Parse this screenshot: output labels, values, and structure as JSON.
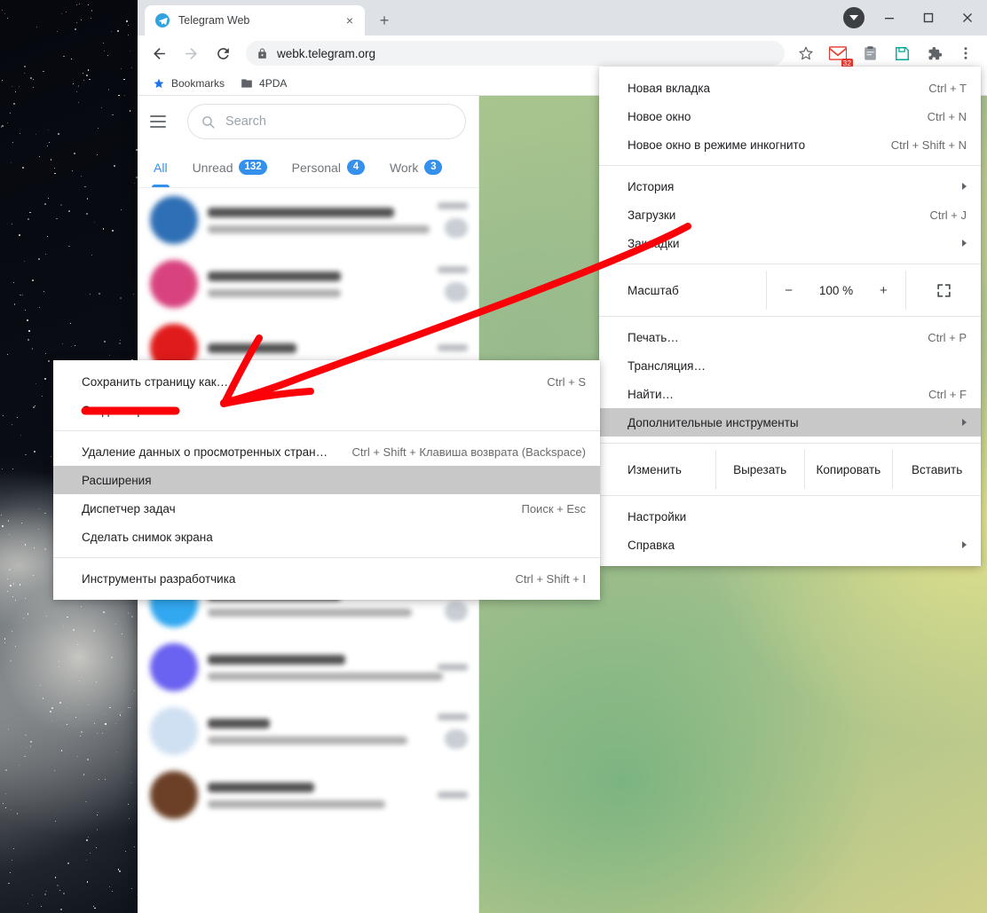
{
  "browser": {
    "tab": {
      "title": "Telegram Web",
      "favicon": "telegram-icon",
      "close": "×"
    },
    "newtab_label": "+",
    "window_controls": {
      "minimize": "—",
      "maximize": "☐",
      "close": "✕"
    },
    "toolbar": {
      "back": "back-arrow-icon",
      "forward": "forward-arrow-icon",
      "reload": "reload-icon",
      "url": "webk.telegram.org",
      "lock": "lock-icon",
      "bookmark_star": "star-icon",
      "gmail_badge": "32",
      "extensions": "puzzle-icon",
      "menu": "three-dot-menu-icon"
    },
    "bookmarks": [
      {
        "label": "Bookmarks",
        "icon": "star-icon"
      },
      {
        "label": "4PDA",
        "icon": "folder-icon"
      }
    ]
  },
  "telegram": {
    "search_placeholder": "Search",
    "menu_icon": "hamburger-icon",
    "tabs": [
      {
        "label": "All",
        "count": "",
        "active": true
      },
      {
        "label": "Unread",
        "count": "132",
        "active": false
      },
      {
        "label": "Personal",
        "count": "4",
        "active": false
      },
      {
        "label": "Work",
        "count": "3",
        "active": false
      }
    ],
    "chats": [
      {
        "avatar_color": "#2f6fb5",
        "title_w": 210,
        "sub_w": 250,
        "unread": true,
        "green": false
      },
      {
        "avatar_color": "#d8437e",
        "title_w": 150,
        "sub_w": 150,
        "unread": true,
        "green": false
      },
      {
        "avatar_color": "#e01b1b",
        "title_w": 100,
        "sub_w": 0,
        "unread": false,
        "green": false
      },
      {
        "avatar_color": "#6d7f8f",
        "title_w": 160,
        "sub_w": 220,
        "unread": true,
        "green": false
      },
      {
        "avatar_color": "#4a2a63",
        "title_w": 80,
        "sub_w": 235,
        "unread": true,
        "green": false
      },
      {
        "avatar_color": "#2ca0e8",
        "title_w": 120,
        "sub_w": 255,
        "unread": false,
        "green": false
      },
      {
        "avatar_color": "#32a8f0",
        "title_w": 150,
        "sub_w": 230,
        "unread": true,
        "green": false
      },
      {
        "avatar_color": "#6a62f0",
        "title_w": 155,
        "sub_w": 265,
        "unread": false,
        "green": true
      },
      {
        "avatar_color": "#cfe0f2",
        "title_w": 70,
        "sub_w": 225,
        "unread": true,
        "green": false
      },
      {
        "avatar_color": "#6b4026",
        "title_w": 120,
        "sub_w": 200,
        "unread": false,
        "green": false
      }
    ]
  },
  "chrome_menu": {
    "items": [
      {
        "label": "Новая вкладка",
        "accel": "Ctrl + T",
        "type": "item"
      },
      {
        "label": "Новое окно",
        "accel": "Ctrl + N",
        "type": "item"
      },
      {
        "label": "Новое окно в режиме инкогнито",
        "accel": "Ctrl + Shift + N",
        "type": "item"
      },
      {
        "type": "separator"
      },
      {
        "label": "История",
        "accel": "",
        "type": "submenu"
      },
      {
        "label": "Загрузки",
        "accel": "Ctrl + J",
        "type": "item"
      },
      {
        "label": "Закладки",
        "accel": "",
        "type": "submenu"
      },
      {
        "type": "separator"
      },
      {
        "type": "zoom",
        "label": "Масштаб",
        "minus": "−",
        "value": "100 %",
        "plus": "+",
        "fullscreen_icon": "fullscreen-icon"
      },
      {
        "type": "separator"
      },
      {
        "label": "Печать…",
        "accel": "Ctrl + P",
        "type": "item"
      },
      {
        "label": "Трансляция…",
        "accel": "",
        "type": "item"
      },
      {
        "label": "Найти…",
        "accel": "Ctrl + F",
        "type": "item"
      },
      {
        "label": "Дополнительные инструменты",
        "accel": "",
        "type": "submenu",
        "highlighted": true
      },
      {
        "type": "separator"
      },
      {
        "type": "edit_row",
        "cells": [
          "Изменить",
          "Вырезать",
          "Копировать",
          "Вставить"
        ]
      },
      {
        "type": "separator"
      },
      {
        "label": "Настройки",
        "accel": "",
        "type": "item"
      },
      {
        "label": "Справка",
        "accel": "",
        "type": "submenu"
      }
    ]
  },
  "more_tools_menu": {
    "items": [
      {
        "label": "Сохранить страницу как…",
        "accel": "Ctrl + S",
        "type": "item"
      },
      {
        "label": "Создать ярлык…",
        "accel": "",
        "type": "item"
      },
      {
        "type": "separator"
      },
      {
        "label": "Удаление данных о просмотренных страницах…",
        "accel": "Ctrl + Shift + Клавиша возврата (Backspace)",
        "type": "item"
      },
      {
        "label": "Расширения",
        "accel": "",
        "type": "item",
        "highlighted": true
      },
      {
        "label": "Диспетчер задач",
        "accel": "Поиск + Esc",
        "type": "item"
      },
      {
        "label": "Сделать снимок экрана",
        "accel": "",
        "type": "item"
      },
      {
        "type": "separator"
      },
      {
        "label": "Инструменты разработчика",
        "accel": "Ctrl + Shift + I",
        "type": "item"
      }
    ]
  },
  "annotation": {
    "color": "#fb0008",
    "arrow_name": "red-arrow-pointing-to-create-shortcut",
    "underline_name": "red-underline-under-create-shortcut"
  },
  "colors": {
    "accent_blue": "#3390ec",
    "chrome_tabstrip": "#dee1e6",
    "menu_highlight": "#c8c8c8",
    "badge_red": "#e8372c",
    "annotation_red": "#fb0008"
  }
}
